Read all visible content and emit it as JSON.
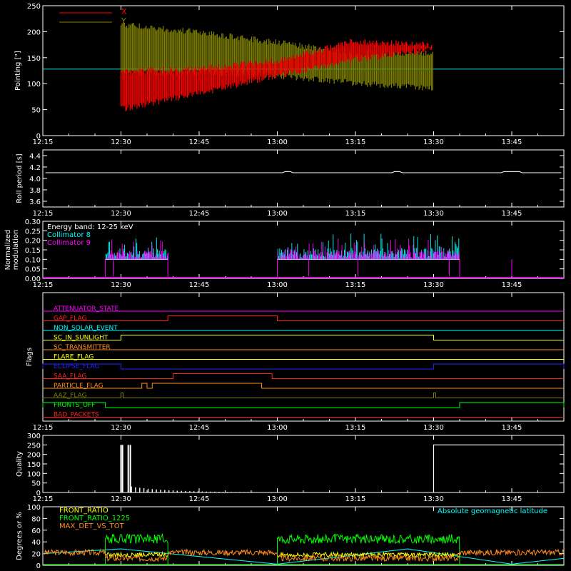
{
  "x_ticks": [
    "12:15",
    "12:30",
    "12:45",
    "13:00",
    "13:15",
    "13:30",
    "13:45"
  ],
  "colors": {
    "bg": "#000000",
    "axes": "#ffffff",
    "x": "#ff0000",
    "y": "#808000",
    "cyan": "#00ffff",
    "magenta": "#ff00ff",
    "yellow": "#ffff00",
    "green": "#00ff00",
    "orange": "#ff8c1a",
    "blue": "#0000ff"
  },
  "chart_data": [
    {
      "id": "pointing",
      "type": "line",
      "ylabel": "Pointing [\"]",
      "ylim": [
        0,
        250
      ],
      "yticks": [
        "0",
        "50",
        "100",
        "150",
        "200",
        "250"
      ],
      "xlim": [
        "12:15",
        "13:55"
      ],
      "reference_line": 128,
      "legend": [
        {
          "name": "X",
          "color": "#ff0000"
        },
        {
          "name": "Y",
          "color": "#808000"
        }
      ],
      "series": [
        {
          "name": "X",
          "envelope_time": [
            "12:30",
            "12:45",
            "13:00",
            "13:15",
            "13:30"
          ],
          "upper": [
            130,
            135,
            150,
            188,
            180
          ],
          "lower": [
            45,
            75,
            110,
            140,
            160
          ]
        },
        {
          "name": "Y",
          "envelope_time": [
            "12:30",
            "12:45",
            "13:00",
            "13:15",
            "13:30"
          ],
          "upper": [
            220,
            205,
            185,
            165,
            165
          ],
          "lower": [
            115,
            115,
            110,
            95,
            85
          ]
        }
      ]
    },
    {
      "id": "roll",
      "type": "line",
      "ylabel": "Roll period [s]",
      "ylim": [
        3.5,
        4.5
      ],
      "yticks": [
        "3.6",
        "3.8",
        "4.0",
        "4.2",
        "4.4"
      ],
      "series": [
        {
          "name": "",
          "value": 4.1
        }
      ]
    },
    {
      "id": "modulation",
      "type": "bar",
      "ylabel_lines": [
        "Normalized",
        "modulation"
      ],
      "ylim": [
        0,
        0.3
      ],
      "yticks": [
        "0.00",
        "0.05",
        "0.10",
        "0.15",
        "0.20",
        "0.25",
        "0.30"
      ],
      "legend": [
        {
          "name": "Energy band: 12-25 keV",
          "color": "#ffffff"
        },
        {
          "name": "Collimator 8",
          "color": "#00ffff"
        },
        {
          "name": "Collimator 9",
          "color": "#ff00ff"
        }
      ],
      "intervals": [
        [
          "12:27",
          "12:39"
        ],
        [
          "13:00",
          "13:35"
        ]
      ],
      "baseline": 0.1,
      "peak_values": [
        0.16,
        0.25,
        0.14,
        0.19,
        0.26,
        0.15,
        0.18,
        0.22,
        0.24,
        0.17,
        0.2
      ]
    },
    {
      "id": "flags",
      "type": "line",
      "ylabel": "Flags",
      "flags": [
        {
          "name": "ATTENUATOR_STATE",
          "color": "#ff00ff",
          "on": []
        },
        {
          "name": "GAP_FLAG",
          "color": "#ff2020",
          "on": [
            [
              "12:39",
              "13:00"
            ]
          ]
        },
        {
          "name": "NON_SOLAR_EVENT",
          "color": "#00ffff",
          "on": []
        },
        {
          "name": "SC_IN_SUNLIGHT",
          "color": "#ffff00",
          "on": [
            [
              "12:30",
              "13:30"
            ]
          ]
        },
        {
          "name": "SC_TRANSMITTER",
          "color": "#ff8c1a",
          "on": []
        },
        {
          "name": "FLARE_FLAG",
          "color": "#ffff00",
          "on": []
        },
        {
          "name": "ECLIPSE_FLAG",
          "color": "#2222ff",
          "on": [
            [
              "12:15",
              "12:30"
            ],
            [
              "13:30",
              "13:55"
            ]
          ]
        },
        {
          "name": "SAA_FLAG",
          "color": "#ff2020",
          "on": [
            [
              "12:40",
              "12:59"
            ]
          ]
        },
        {
          "name": "PARTICLE_FLAG",
          "color": "#ff8c1a",
          "on": [
            [
              "12:34",
              "12:35"
            ],
            [
              "12:36",
              "12:57"
            ]
          ]
        },
        {
          "name": "AAZ_FLAG",
          "color": "#808000",
          "on": [
            [
              "12:30",
              "12:30.4"
            ],
            [
              "13:30",
              "13:30.4"
            ]
          ]
        },
        {
          "name": "FRONTS_OFF",
          "color": "#00ff00",
          "on": [
            [
              "12:15",
              "12:27"
            ],
            [
              "13:35",
              "13:55"
            ]
          ]
        },
        {
          "name": "BAD_PACKETS",
          "color": "#ff2020",
          "on": []
        }
      ]
    },
    {
      "id": "quality",
      "type": "line",
      "ylabel": "Quality",
      "ylim": [
        0,
        300
      ],
      "yticks": [
        "0",
        "50",
        "100",
        "150",
        "200",
        "250",
        "300"
      ],
      "events": [
        [
          "12:30",
          "12:31",
          250
        ],
        [
          "12:31",
          "12:32",
          250
        ],
        [
          "13:30",
          "13:55",
          250
        ]
      ]
    },
    {
      "id": "ratios",
      "type": "line",
      "ylabel": "Degrees or %",
      "ylim": [
        0,
        100
      ],
      "yticks": [
        "0",
        "20",
        "40",
        "60",
        "80",
        "100"
      ],
      "legend": [
        {
          "name": "FRONT_RATIO",
          "color": "#ffff00"
        },
        {
          "name": "FRONT_RATIO_1225",
          "color": "#00ff00"
        },
        {
          "name": "MAX_DET_VS_TOT",
          "color": "#ff8c1a"
        }
      ],
      "right_label": "Absolute geomagnetic latitude",
      "latitude": {
        "time": [
          "12:15",
          "12:30",
          "13:00",
          "13:25",
          "13:45",
          "13:55"
        ],
        "value": [
          20,
          28,
          2,
          28,
          2,
          12
        ]
      },
      "series": [
        {
          "name": "FRONT_RATIO_1225",
          "level_on": 45,
          "intervals": [
            [
              "12:27",
              "12:39"
            ],
            [
              "13:00",
              "13:35"
            ]
          ]
        },
        {
          "name": "FRONT_RATIO",
          "level_on": 18,
          "intervals": [
            [
              "12:27",
              "12:39"
            ],
            [
              "13:00",
              "13:35"
            ]
          ]
        },
        {
          "name": "MAX_DET_VS_TOT",
          "level": 22,
          "level_on": 12
        }
      ]
    }
  ]
}
